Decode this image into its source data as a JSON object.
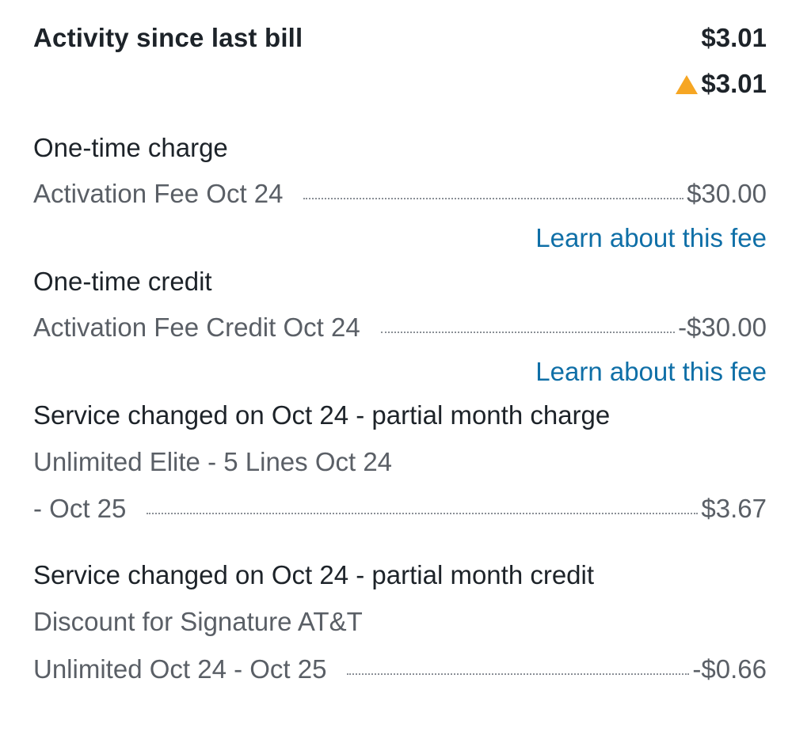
{
  "header": {
    "title": "Activity since last bill",
    "amount": "$3.01",
    "change_amount": "$3.01",
    "change_icon": "warning-triangle-icon",
    "change_icon_color": "#f6a623"
  },
  "sections": [
    {
      "title": "One-time charge",
      "item_label": "Activation Fee Oct 24",
      "item_amount": "$30.00",
      "link": "Learn about this fee"
    },
    {
      "title": "One-time credit",
      "item_label": "Activation Fee Credit Oct 24",
      "item_amount": "-$30.00",
      "link": "Learn about this fee"
    },
    {
      "title": "Service changed on Oct 24 - partial month charge",
      "item_line1": "Unlimited Elite - 5 Lines Oct 24",
      "item_label": "- Oct 25",
      "item_amount": "$3.67"
    },
    {
      "title": "Service changed on Oct 24 - partial month credit",
      "item_line1": "Discount for Signature AT&T",
      "item_label": "Unlimited Oct 24 - Oct 25",
      "item_amount": "-$0.66"
    }
  ],
  "colors": {
    "text_primary": "#1d2329",
    "text_secondary": "#5a5f66",
    "link": "#0f6fa7",
    "accent_warning": "#f6a623"
  }
}
